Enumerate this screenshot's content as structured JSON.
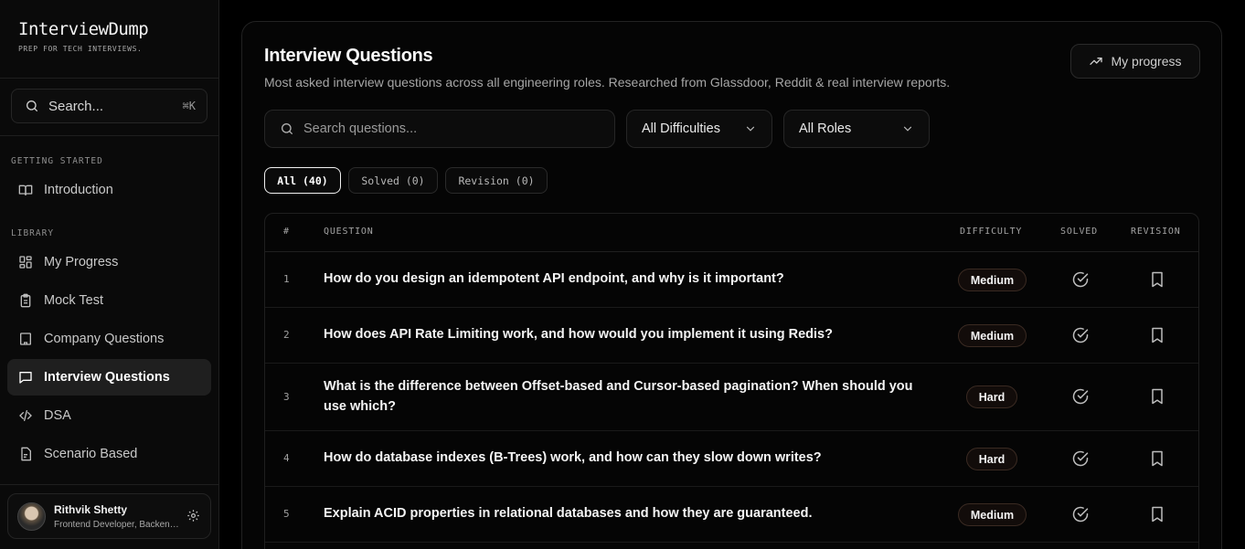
{
  "brand": {
    "title": "InterviewDump",
    "subtitle": "PREP FOR TECH INTERVIEWS."
  },
  "sidebar": {
    "search_label": "Search...",
    "search_shortcut": "⌘K",
    "sections": [
      {
        "label": "GETTING STARTED",
        "items": [
          {
            "label": "Introduction",
            "icon": "book-icon",
            "active": false
          }
        ]
      },
      {
        "label": "LIBRARY",
        "items": [
          {
            "label": "My Progress",
            "icon": "grid-icon",
            "active": false
          },
          {
            "label": "Mock Test",
            "icon": "clipboard-icon",
            "active": false
          },
          {
            "label": "Company Questions",
            "icon": "building-icon",
            "active": false
          },
          {
            "label": "Interview Questions",
            "icon": "message-icon",
            "active": true
          },
          {
            "label": "DSA",
            "icon": "code-icon",
            "active": false
          },
          {
            "label": "Scenario Based",
            "icon": "file-icon",
            "active": false
          }
        ]
      }
    ],
    "user": {
      "name": "Rithvik Shetty",
      "role": "Frontend Developer, Backend Developer"
    }
  },
  "main": {
    "title": "Interview Questions",
    "subtitle": "Most asked interview questions across all engineering roles. Researched from Glassdoor, Reddit & real interview reports.",
    "progress_button": "My progress",
    "search_placeholder": "Search questions...",
    "difficulty_filter": "All Difficulties",
    "role_filter": "All Roles",
    "tabs": [
      {
        "label": "All (40)",
        "active": true
      },
      {
        "label": "Solved (0)",
        "active": false
      },
      {
        "label": "Revision (0)",
        "active": false
      }
    ],
    "table": {
      "headers": {
        "num": "#",
        "question": "QUESTION",
        "difficulty": "DIFFICULTY",
        "solved": "SOLVED",
        "revision": "REVISION"
      },
      "rows": [
        {
          "num": "1",
          "question": "How do you design an idempotent API endpoint, and why is it important?",
          "difficulty": "Medium"
        },
        {
          "num": "2",
          "question": "How does API Rate Limiting work, and how would you implement it using Redis?",
          "difficulty": "Medium"
        },
        {
          "num": "3",
          "question": "What is the difference between Offset-based and Cursor-based pagination? When should you use which?",
          "difficulty": "Hard"
        },
        {
          "num": "4",
          "question": "How do database indexes (B-Trees) work, and how can they slow down writes?",
          "difficulty": "Hard"
        },
        {
          "num": "5",
          "question": "Explain ACID properties in relational databases and how they are guaranteed.",
          "difficulty": "Medium"
        }
      ]
    }
  }
}
